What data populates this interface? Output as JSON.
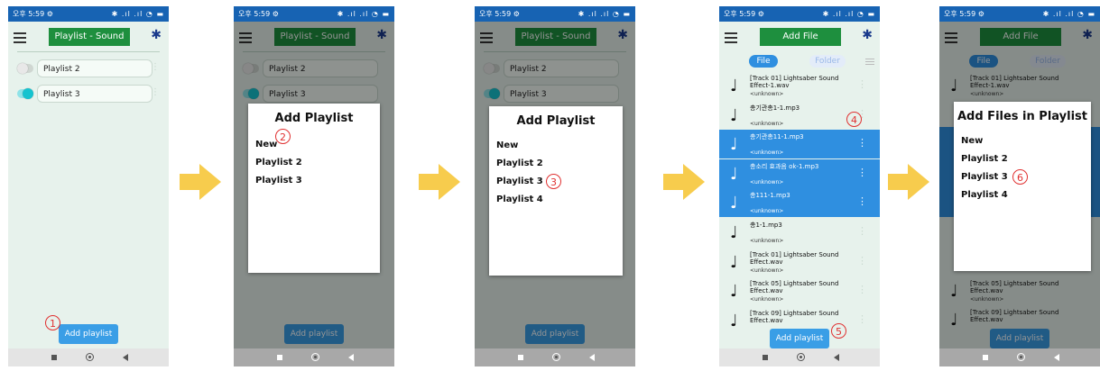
{
  "status_bar": {
    "time": "오후 5:59 ⚙",
    "icons": "✱ .ıl .ıl ◔ ▬"
  },
  "common": {
    "bluetooth_icon": "bluetooth-icon",
    "add_playlist_label": "Add playlist"
  },
  "screen1": {
    "title": "Playlist - Sound",
    "playlists": [
      {
        "name": "Playlist 2",
        "enabled": false
      },
      {
        "name": "Playlist 3",
        "enabled": true
      }
    ],
    "marker": "1"
  },
  "screen2": {
    "title": "Playlist - Sound",
    "dialog_title": "Add Playlist",
    "options": [
      "New",
      "Playlist 2",
      "Playlist 3"
    ],
    "marker": "2"
  },
  "screen3": {
    "title": "Playlist - Sound",
    "dialog_title": "Add Playlist",
    "options": [
      "New",
      "Playlist 2",
      "Playlist 3",
      "Playlist 4"
    ],
    "marker": "3"
  },
  "screen4": {
    "title": "Add File",
    "tabs": {
      "file": "File",
      "folder": "Folder"
    },
    "files": [
      {
        "name": "[Track 01] Lightsaber Sound Effect-1.wav",
        "artist": "<unknown>",
        "selected": false
      },
      {
        "name": "총기관총1-1.mp3",
        "artist": "<unknown>",
        "selected": false
      },
      {
        "name": "총기관총11-1.mp3",
        "artist": "<unknown>",
        "selected": true
      },
      {
        "name": "총소리 효과음 ok-1.mp3",
        "artist": "<unknown>",
        "selected": true
      },
      {
        "name": "총111-1.mp3",
        "artist": "<unknown>",
        "selected": true
      },
      {
        "name": "총1-1.mp3",
        "artist": "<unknown>",
        "selected": false
      },
      {
        "name": "[Track 01] Lightsaber Sound Effect.wav",
        "artist": "<unknown>",
        "selected": false
      },
      {
        "name": "[Track 05] Lightsaber Sound Effect.wav",
        "artist": "<unknown>",
        "selected": false
      },
      {
        "name": "[Track 09] Lightsaber Sound Effect.wav",
        "artist": "",
        "selected": false
      }
    ],
    "marker_selection": "4",
    "marker_button": "5"
  },
  "screen5": {
    "title": "Add File",
    "dialog_title": "Add Files in Playlist",
    "options": [
      "New",
      "Playlist 2",
      "Playlist 3",
      "Playlist 4"
    ],
    "marker": "6",
    "bg_files": [
      {
        "name": "[Track 01] Lightsaber Sound Effect-1.wav",
        "artist": "<unknown>"
      },
      {
        "name": "[Track 05] Lightsaber Sound Effect.wav",
        "artist": "<unknown>"
      },
      {
        "name": "[Track 09] Lightsaber Sound Effect.wav",
        "artist": ""
      }
    ]
  },
  "colors": {
    "accent": "#1e8f3e",
    "selection": "#2f8fe0",
    "status_bar": "#1763b3",
    "arrow": "#f7cc4d",
    "marker": "#e03030"
  }
}
